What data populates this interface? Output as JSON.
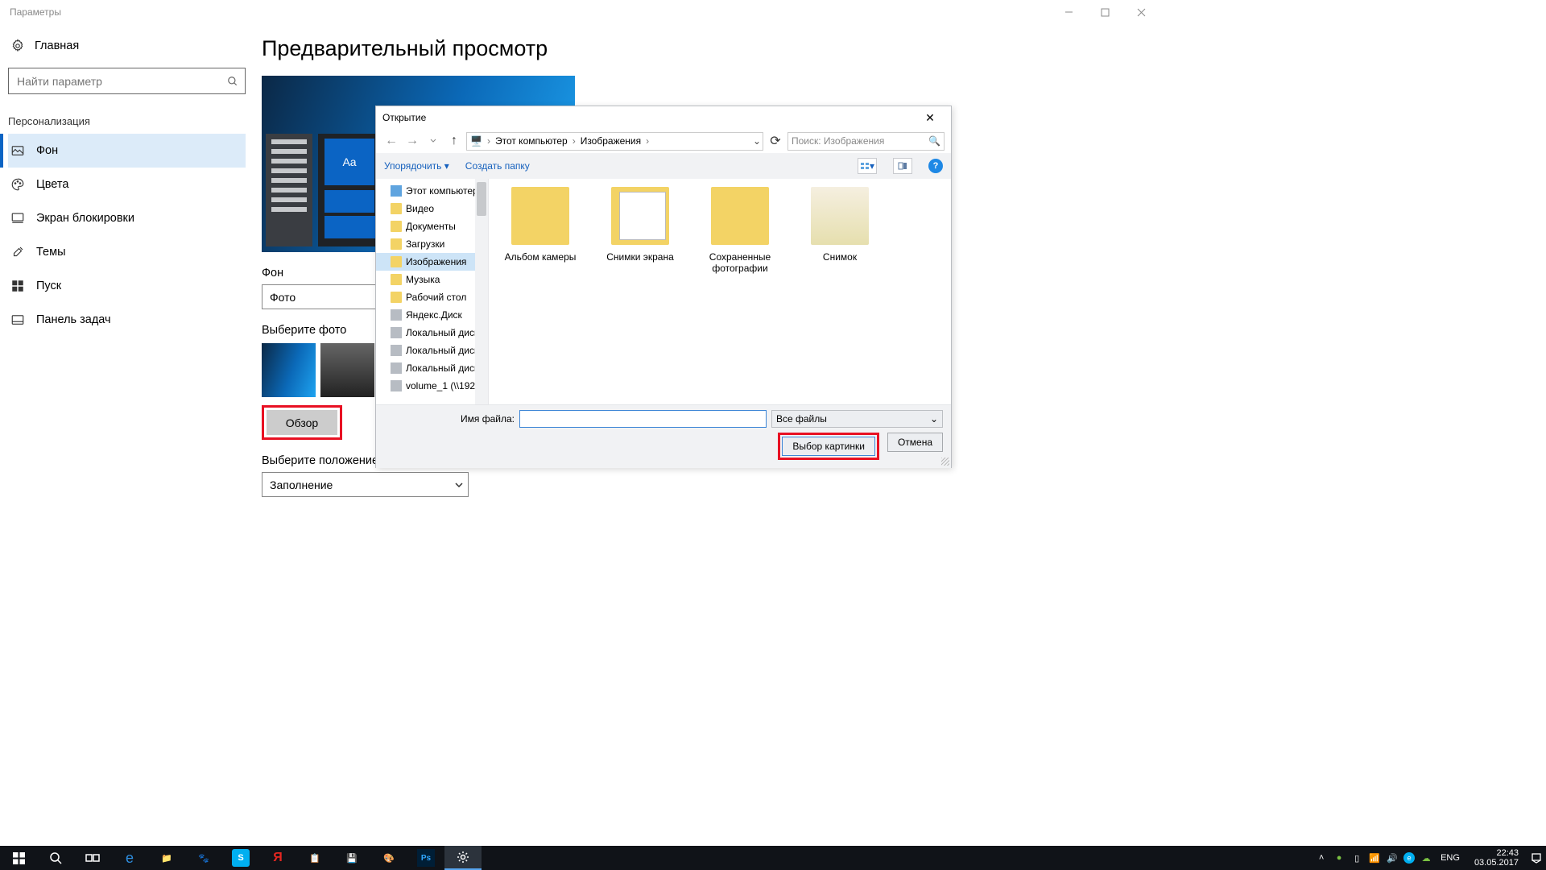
{
  "window": {
    "title": "Параметры"
  },
  "settings": {
    "home": "Главная",
    "search_placeholder": "Найти параметр",
    "section": "Персонализация",
    "nav": [
      {
        "label": "Фон",
        "active": true
      },
      {
        "label": "Цвета"
      },
      {
        "label": "Экран блокировки"
      },
      {
        "label": "Темы"
      },
      {
        "label": "Пуск"
      },
      {
        "label": "Панель задач"
      }
    ],
    "page_title": "Предварительный просмотр",
    "preview_sample": "Aa",
    "bg_label": "Фон",
    "bg_value": "Фото",
    "choose_photo": "Выберите фото",
    "browse": "Обзор",
    "fit_label": "Выберите положение",
    "fit_value": "Заполнение"
  },
  "dialog": {
    "title": "Открытие",
    "path": [
      "Этот компьютер",
      "Изображения"
    ],
    "search_placeholder": "Поиск: Изображения",
    "organize": "Упорядочить",
    "new_folder": "Создать папку",
    "tree": [
      "Этот компьютер",
      "Видео",
      "Документы",
      "Загрузки",
      "Изображения",
      "Музыка",
      "Рабочий стол",
      "Яндекс.Диск",
      "Локальный диск",
      "Локальный диск",
      "Локальный диск",
      "volume_1 (\\\\192"
    ],
    "tree_selected_index": 4,
    "files": [
      {
        "name": "Альбом камеры",
        "kind": "folder"
      },
      {
        "name": "Снимки экрана",
        "kind": "shots"
      },
      {
        "name": "Сохраненные фотографии",
        "kind": "folder"
      },
      {
        "name": "Снимок",
        "kind": "snap"
      }
    ],
    "filename_label": "Имя файла:",
    "filetype": "Все файлы",
    "primary": "Выбор картинки",
    "cancel": "Отмена"
  },
  "taskbar": {
    "lang": "ENG",
    "time": "22:43",
    "date": "03.05.2017"
  }
}
